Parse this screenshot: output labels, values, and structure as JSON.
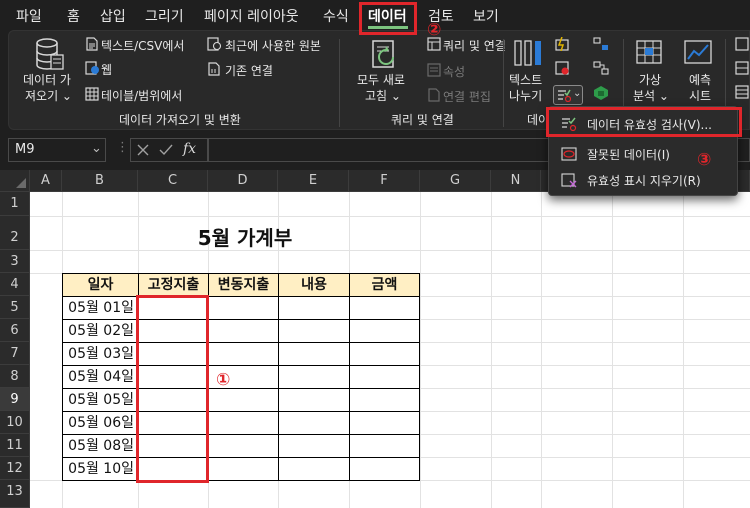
{
  "menu": {
    "items": [
      "파일",
      "홈",
      "삽입",
      "그리기",
      "페이지 레이아웃",
      "수식",
      "데이터",
      "검토",
      "보기"
    ],
    "active": "데이터"
  },
  "ribbon": {
    "get_data": {
      "label_line1": "데이터 가",
      "label_line2": "져오기 ⌄"
    },
    "from_text_csv": "텍스트/CSV에서",
    "from_web": "웹",
    "from_table": "테이블/범위에서",
    "recent_sources": "최근에 사용한 원본",
    "existing_connections": "기존 연결",
    "group1_label": "데이터 가져오기 및 변환",
    "refresh_all": {
      "line1": "모두 새로",
      "line2": "고침 ⌄"
    },
    "queries_connections": "쿼리 및 연결",
    "properties": "속성",
    "edit_links": "연결 편집",
    "group2_label": "쿼리 및 연결",
    "text_to_columns": {
      "line1": "텍스트",
      "line2": "나누기"
    },
    "group3_label": "데이",
    "what_if": {
      "line1": "가상",
      "line2": "분석 ⌄"
    },
    "forecast": {
      "line1": "예측",
      "line2": "시트"
    }
  },
  "dropdown": {
    "items": [
      "데이터 유효성 검사(V)...",
      "잘못된 데이터(I)",
      "유효성 표시 지우기(R)"
    ]
  },
  "formula_bar": {
    "name_box": "M9",
    "fx": "fx",
    "value": ""
  },
  "sheet": {
    "columns": [
      "A",
      "B",
      "C",
      "D",
      "E",
      "F",
      "G",
      "N",
      "O"
    ],
    "rows": [
      "1",
      "2",
      "3",
      "4",
      "5",
      "6",
      "7",
      "8",
      "9",
      "10",
      "11",
      "12",
      "13"
    ],
    "title": "5월 가계부",
    "headers": [
      "일자",
      "고정지출",
      "변동지출",
      "내용",
      "금액"
    ],
    "dates": [
      "05월 01일",
      "05월 02일",
      "05월 03일",
      "05월 04일",
      "05월 05일",
      "05월 06일",
      "05월 08일",
      "05월 10일"
    ]
  },
  "annotations": {
    "step1": "①",
    "step2": "②",
    "step3": "③"
  },
  "colors": {
    "accent": "#7cc47f",
    "highlight": "#e0262b",
    "header_fill": "#ffefc4"
  }
}
